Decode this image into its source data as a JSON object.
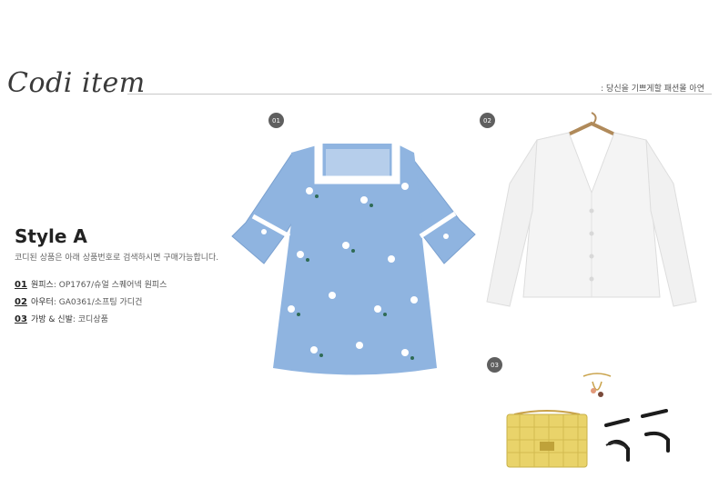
{
  "header": {
    "logo_text": "Codi item",
    "tagline": ": 당신을 기쁘게할 패션몰 아연"
  },
  "style": {
    "title": "Style A",
    "description": "코디된 상품은 아래 상품번호로 검색하시면 구매가능합니다."
  },
  "items": [
    {
      "num": "01",
      "label": "원피스",
      "value": " : OP1767/슈얼 스퀘어넥 원피스"
    },
    {
      "num": "02",
      "label": "아우터",
      "value": " : GA0361/소프팅 가디건"
    },
    {
      "num": "03",
      "label": "가방 & 신발",
      "value": "  : 코디상품"
    }
  ],
  "badges": [
    "01",
    "02",
    "03"
  ],
  "colors": {
    "dress": "#8fb4e0",
    "cardigan": "#f4f4f4",
    "bag": "#e9d36a",
    "badge": "#5f5f5f"
  }
}
